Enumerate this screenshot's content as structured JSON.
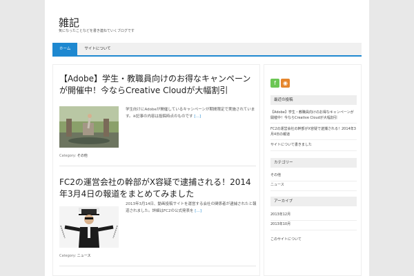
{
  "site": {
    "title": "雑記",
    "description": "気になったことなどを書き連ねていくブログです"
  },
  "nav": [
    {
      "label": "ホーム",
      "active": true
    },
    {
      "label": "サイトについて",
      "active": false
    }
  ],
  "posts": [
    {
      "title": "【Adobe】学生・教職員向けのお得なキャンペーンが開催中！今ならCreative Cloudが大幅割引",
      "excerpt": "学生向けにAdobeが開催しているキャンペーンが期間限定で実施されています。※記事の内容は投稿時点のものです",
      "more": "[…]",
      "category_label": "Category:",
      "category": "その他"
    },
    {
      "title": "FC2の運営会社の幹部がX容疑で逮捕される！2014年3月4日の報道をまとめてみました",
      "excerpt": "2013年3月14日、動画投稿サイトを運営する会社の関係者が逮捕されたと報道されました。詳細はFC2の公式発表を",
      "more": "[…]",
      "category_label": "Category:",
      "category": "ニュース"
    }
  ],
  "sidebar": {
    "social": [
      {
        "name": "feedly-icon",
        "glyph": "f",
        "color": "#6cc655"
      },
      {
        "name": "rss-icon",
        "glyph": "◉",
        "color": "#e5862d"
      }
    ],
    "recent": {
      "heading": "最近の投稿",
      "items": [
        "【Adobe】学生・教職員向けのお得なキャンペーンが開催中！今ならCreative Cloudが大幅割引",
        "FC2の運営会社の幹部がX容疑で逮捕される！2014年3月4日の報道",
        "サイトについて書きました"
      ]
    },
    "categories": {
      "heading": "カテゴリー",
      "items": [
        "その他",
        "ニュース"
      ]
    },
    "archives": {
      "heading": "アーカイブ",
      "items": [
        "2013年12月",
        "2013年10月"
      ]
    },
    "footer_link": "このサイトについて"
  }
}
